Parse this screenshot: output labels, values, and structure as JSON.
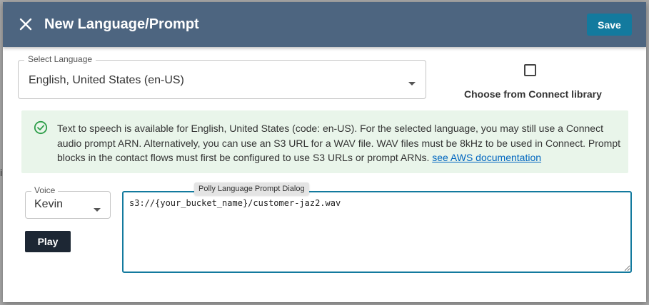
{
  "background": {
    "partial_char": "i"
  },
  "dialog": {
    "title": "New Language/Prompt",
    "save_label": "Save"
  },
  "language": {
    "legend": "Select Language",
    "value": "English, United States (en-US)"
  },
  "library": {
    "label": "Choose from Connect library",
    "checked": false
  },
  "info": {
    "text": "Text to speech is available for English, United States (code: en-US). For the selected language, you may still use a Connect audio prompt ARN. Alternatively, you can use an S3 URL for a WAV file. WAV files must be 8kHz to be used in Connect. Prompt blocks in the contact flows must first be configured to use S3 URLs or prompt ARNs.",
    "link_text": "see AWS documentation"
  },
  "voice": {
    "legend": "Voice",
    "value": "Kevin"
  },
  "play_label": "Play",
  "prompt_input": {
    "value": "s3://{your_bucket_name}/customer-jaz2.wav"
  },
  "tooltip": "Polly Language Prompt Dialog",
  "colors": {
    "header": "#4d6580",
    "save": "#137a9e",
    "info_bg": "#e9f5ea",
    "info_icon": "#2e9e4a",
    "link": "#0066c0",
    "play": "#1d2734"
  }
}
